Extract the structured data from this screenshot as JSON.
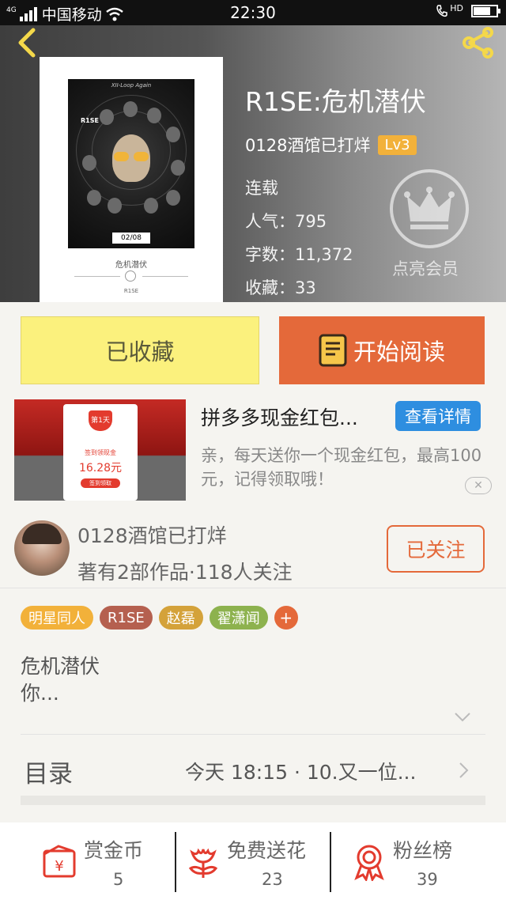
{
  "status_bar": {
    "carrier": "中国移动",
    "network": "4G",
    "time": "22:30",
    "hd": "HD"
  },
  "header": {
    "title": "R1SE:危机潜伏",
    "author": "0128酒馆已打烊",
    "level": "Lv3",
    "status": "连载",
    "popularity": "人气：795",
    "words": "字数：11,372",
    "favorites": "收藏：33",
    "member_label": "点亮会员",
    "cover": {
      "top_text": "XII-Loop Again",
      "brand_mark": "R1SE",
      "date": "02/08",
      "subtitle": "危机潜伏",
      "brand": "R1SE"
    }
  },
  "actions": {
    "collect_label": "已收藏",
    "read_label": "开始阅读"
  },
  "ad": {
    "title": "拼多多现金红包...",
    "detail_label": "查看详情",
    "description": "亲，每天送你一个现金红包，最高100元，记得领取哦！",
    "card_day": "第1天",
    "card_text": "签到领现金",
    "card_amount": "16.28元",
    "card_button": "签到领取",
    "close": "✕"
  },
  "author": {
    "name": "0128酒馆已打烊",
    "info": "著有2部作品·118人关注",
    "follow_label": "已关注"
  },
  "tags": [
    {
      "label": "明星同人",
      "color": "#f2b13a"
    },
    {
      "label": "R1SE",
      "color": "#b5604f"
    },
    {
      "label": "赵磊",
      "color": "#d4a23a"
    },
    {
      "label": "翟潇闻",
      "color": "#8db24e"
    }
  ],
  "tag_add": "+",
  "description": {
    "line1": "危机潜伏",
    "line2": "你..."
  },
  "toc": {
    "label": "目录",
    "latest": "今天 18:15 · 10.又一位..."
  },
  "bottom": [
    {
      "label": "赏金币",
      "value": "5",
      "icon": "gold-coin-icon"
    },
    {
      "label": "免费送花",
      "value": "23",
      "icon": "flower-icon"
    },
    {
      "label": "粉丝榜",
      "value": "39",
      "icon": "medal-icon"
    }
  ],
  "colors": {
    "accent": "#e4693a",
    "collect_bg": "#fbf17d",
    "level_bg": "#f2b13a",
    "detail_bg": "#2e8ee0"
  }
}
